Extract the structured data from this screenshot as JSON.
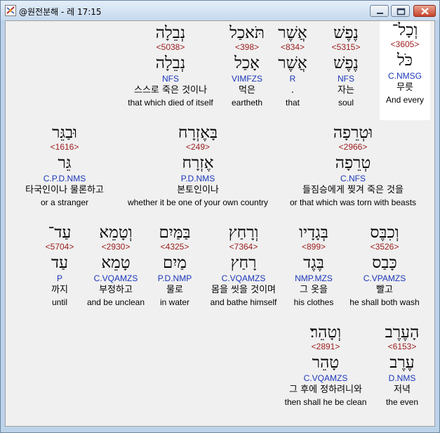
{
  "window": {
    "title": "@원전분해 - 레 17:15"
  },
  "words": [
    {
      "hebrew": "וְכָל־",
      "strong": "<3605>",
      "lemma": "כֹּל",
      "morph": "C.NMSG",
      "korean": "무릇",
      "english": "And every",
      "selected": true
    },
    {
      "hebrew": "נֶפֶשׁ",
      "strong": "<5315>",
      "lemma": "נֶפֶשׁ",
      "morph": "NFS",
      "korean": "자는",
      "english": "soul"
    },
    {
      "hebrew": "אֲשֶׁר",
      "strong": "<834>",
      "lemma": "אֲשֶׁר",
      "morph": "R",
      "korean": ".",
      "english": "that"
    },
    {
      "hebrew": "תֹּאכַל",
      "strong": "<398>",
      "lemma": "אָכַל",
      "morph": "VIMFZS",
      "korean": "먹은",
      "english": "eartheth"
    },
    {
      "hebrew": "נְבֵלָה",
      "strong": "<5038>",
      "lemma": "נְבֵלָה",
      "morph": "NFS",
      "korean": "스스로 죽은 것이나",
      "english": "that which died of itself"
    },
    {
      "hebrew": "וּטְרֵפָה",
      "strong": "<2966>",
      "lemma": "טְרֵפָה",
      "morph": "C.NFS",
      "korean": "들짐승에게 찢겨 죽은 것을",
      "english": "or that which was torn with beasts"
    },
    {
      "hebrew": "בָּאֶזְרָח",
      "strong": "<249>",
      "lemma": "אֶזְרָח",
      "morph": "P.D.NMS",
      "korean": "본토인이나",
      "english": "whether it be one of your own country"
    },
    {
      "hebrew": "וּבַגֵּר",
      "strong": "<1616>",
      "lemma": "גֵּר",
      "morph": "C.P.D.NMS",
      "korean": "타국인이나 물론하고",
      "english": "or a stranger"
    },
    {
      "hebrew": "וְכִבֶּס",
      "strong": "<3526>",
      "lemma": "כָּבַס",
      "morph": "C.VPAMZS",
      "korean": "빨고",
      "english": "he shall both wash"
    },
    {
      "hebrew": "בְּגָדָיו",
      "strong": "<899>",
      "lemma": "בֶּגֶד",
      "morph": "NMP.MZS",
      "korean": "그 옷을",
      "english": "his clothes"
    },
    {
      "hebrew": "וְרָחַץ",
      "strong": "<7364>",
      "lemma": "רָחַץ",
      "morph": "C.VQAMZS",
      "korean": "몸을 씻을 것이며",
      "english": "and bathe himself"
    },
    {
      "hebrew": "בַּמַּיִם",
      "strong": "<4325>",
      "lemma": "מַיִם",
      "morph": "P.D.NMP",
      "korean": "물로",
      "english": "in water"
    },
    {
      "hebrew": "וְטָמֵא",
      "strong": "<2930>",
      "lemma": "טָמֵא",
      "morph": "C.VQAMZS",
      "korean": "부정하고",
      "english": "and be unclean"
    },
    {
      "hebrew": "עַד־",
      "strong": "<5704>",
      "lemma": "עַד",
      "morph": "P",
      "korean": "까지",
      "english": "until"
    },
    {
      "hebrew": "הָעֶרֶב",
      "strong": "<6153>",
      "lemma": "עֶרֶב",
      "morph": "D.NMS",
      "korean": "저녁",
      "english": "the even"
    },
    {
      "hebrew": "וְטָהֵר׃",
      "strong": "<2891>",
      "lemma": "טָהֵר",
      "morph": "C.VQAMZS",
      "korean": "그 후에 정하려니와",
      "english": "then shall he be clean"
    }
  ],
  "colors": {
    "strong": "#9b1b1b",
    "morph": "#1a36b8",
    "close_button": "#c7432a"
  },
  "icons": {
    "app": "app-logo-icon",
    "minimize": "minimize-icon",
    "maximize": "maximize-icon",
    "close": "close-icon"
  }
}
